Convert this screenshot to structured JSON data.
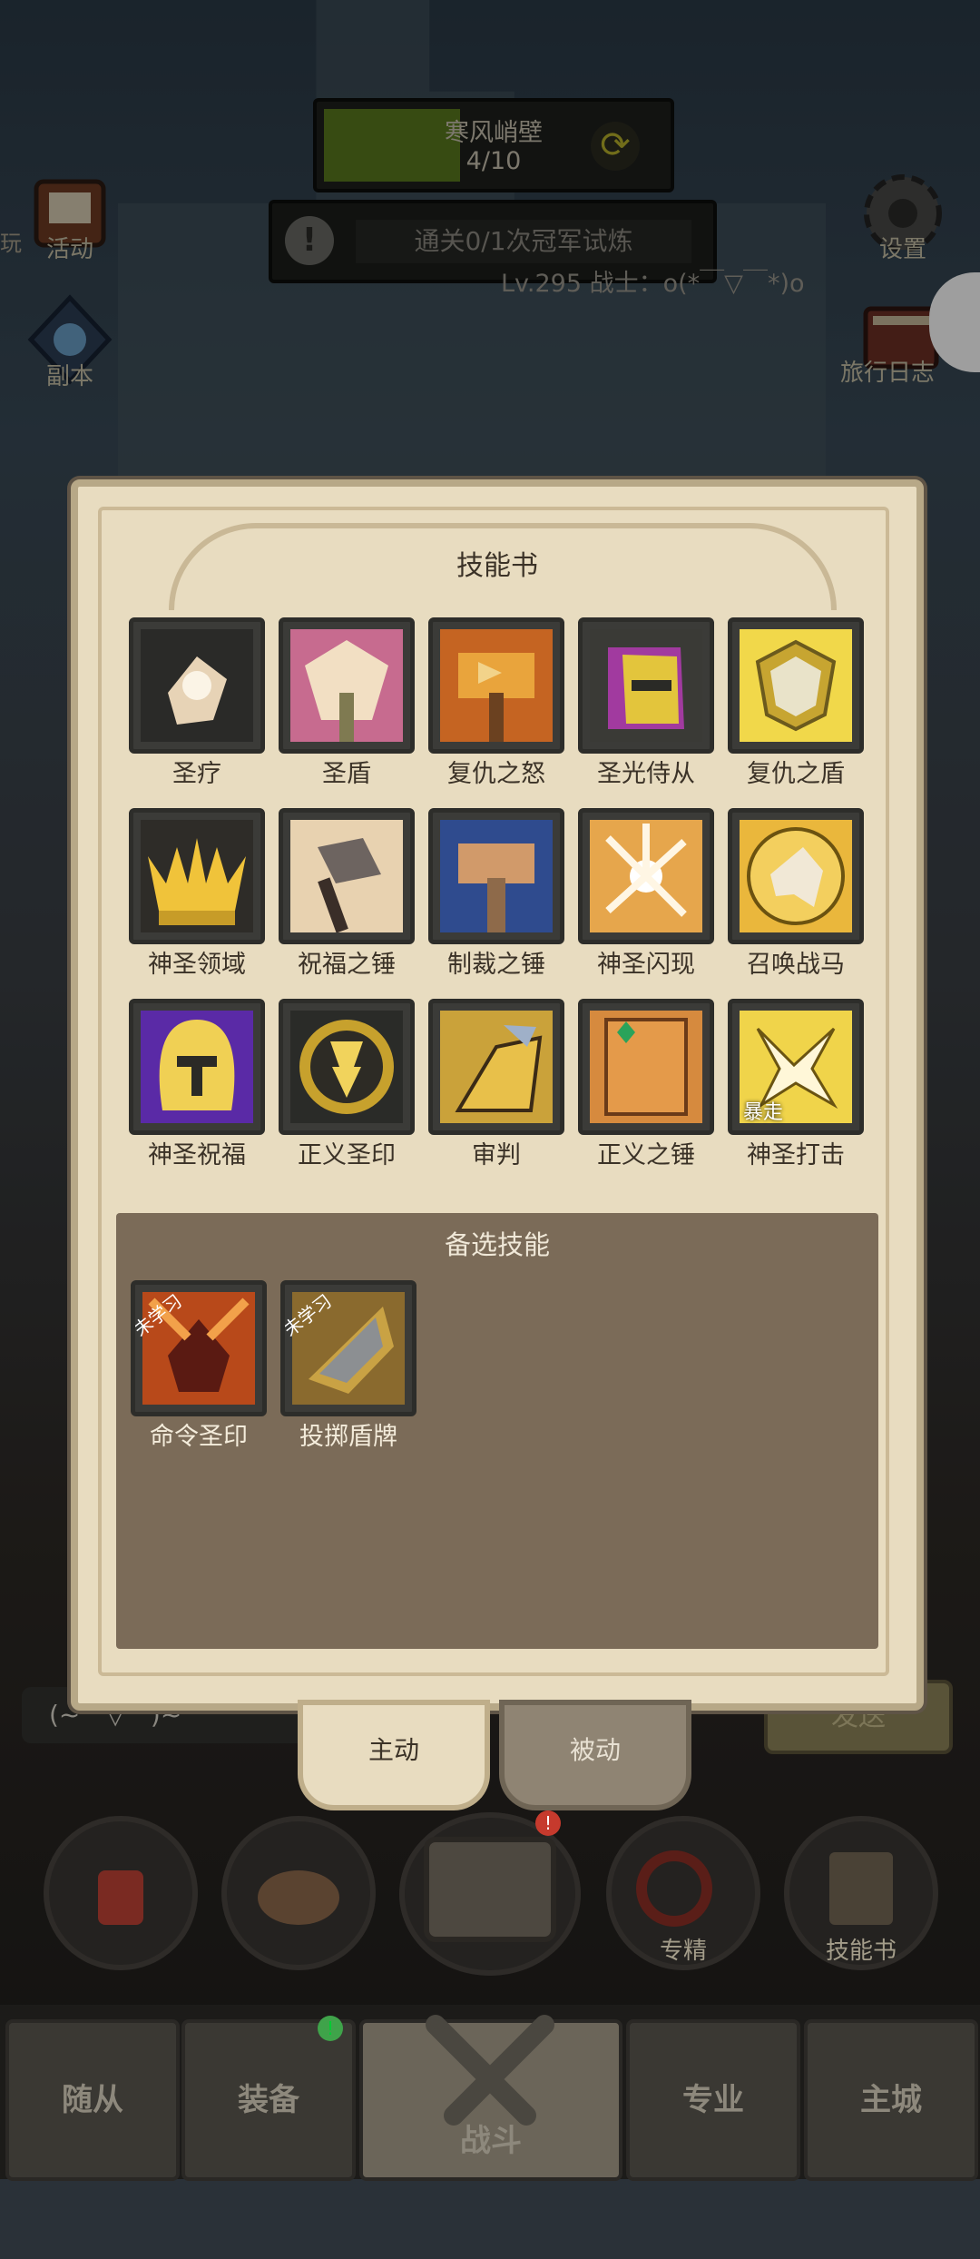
{
  "hud": {
    "stage_name": "寒风峭壁",
    "stage_progress": "4/10",
    "trial_text": "通关0/1次冠军试炼",
    "player_line": "Lv.295 战士：o(*￣▽￣*)o",
    "left_edge_text": "玩"
  },
  "side_buttons": {
    "activity": "活动",
    "dungeon": "副本",
    "settings": "设置",
    "journal": "旅行日志"
  },
  "panel": {
    "title": "技能书",
    "skills": [
      {
        "name": "圣疗"
      },
      {
        "name": "圣盾"
      },
      {
        "name": "复仇之怒"
      },
      {
        "name": "圣光侍从"
      },
      {
        "name": "复仇之盾"
      },
      {
        "name": "神圣领域"
      },
      {
        "name": "祝福之锤"
      },
      {
        "name": "制裁之锤"
      },
      {
        "name": "神圣闪现"
      },
      {
        "name": "召唤战马"
      },
      {
        "name": "神圣祝福"
      },
      {
        "name": "正义圣印"
      },
      {
        "name": "审判"
      },
      {
        "name": "正义之锤"
      },
      {
        "name": "神圣打击",
        "tag": "暴走"
      }
    ],
    "alt_title": "备选技能",
    "alt_skills": [
      {
        "name": "命令圣印",
        "ribbon": "未学习"
      },
      {
        "name": "投掷盾牌",
        "ribbon": "未学习"
      }
    ]
  },
  "tabs": {
    "active": "主动",
    "passive": "被动"
  },
  "chat": {
    "input_text": "(~￣▽￣)~",
    "send_label": "发送"
  },
  "actions": {
    "specialize": "专精",
    "skillbook": "技能书"
  },
  "nav": {
    "followers": "随从",
    "equipment": "装备",
    "battle": "战斗",
    "profession": "专业",
    "main_city": "主城"
  },
  "colors": {
    "panel_bg": "#e8dcc0",
    "alt_bg": "#7b6b58",
    "stage_fill": "#5a7a1e"
  }
}
